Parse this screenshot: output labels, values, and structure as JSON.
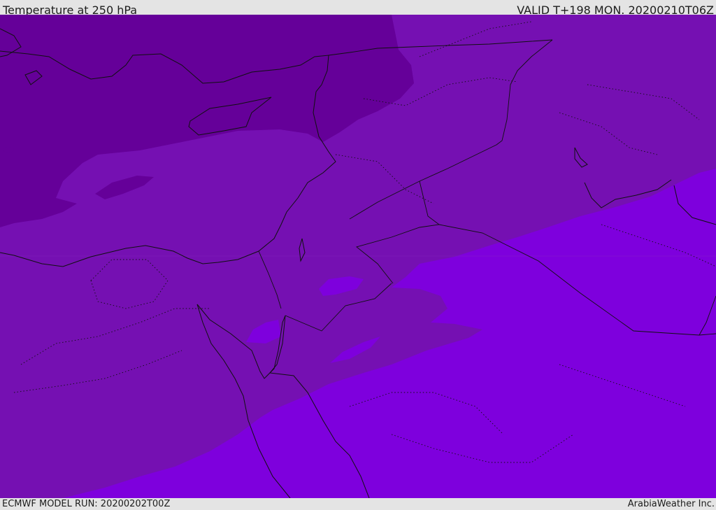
{
  "header": {
    "title": "Temperature at 250 hPa",
    "valid": "VALID T+198 MON. 20200210T06Z"
  },
  "footer": {
    "model_run": "ECMWF MODEL RUN: 20200202T00Z",
    "credit": "ArabiaWeather Inc."
  },
  "map": {
    "variable": "temperature",
    "level": "250 hPa",
    "colors": {
      "coldest_band": "#650099",
      "middle_band": "#7510b2",
      "warmest_band": "#7e00dd",
      "boundary_lines": "#101010"
    }
  }
}
